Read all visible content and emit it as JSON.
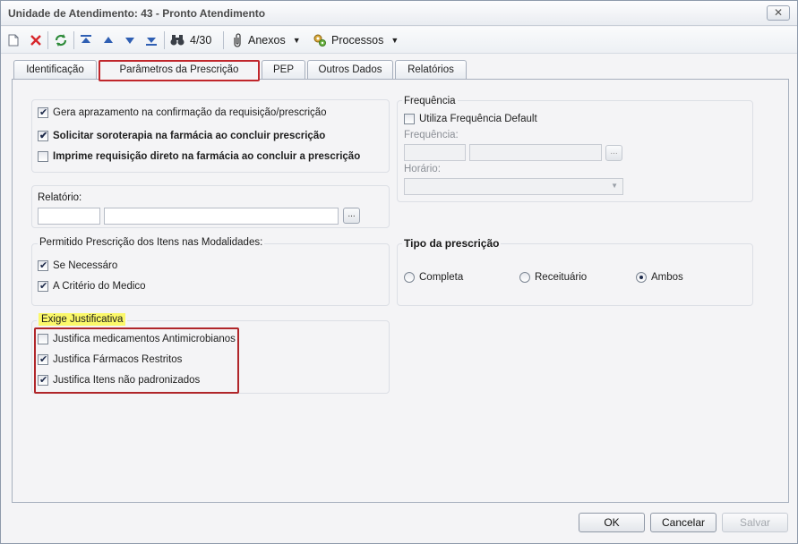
{
  "window": {
    "title": "Unidade de Atendimento: 43 - Pronto Atendimento",
    "close_symbol": "✕"
  },
  "toolbar": {
    "record_counter": "4/30",
    "anexos_label": "Anexos",
    "processos_label": "Processos",
    "icons": [
      "new-document-icon",
      "delete-icon",
      "refresh-icon",
      "first-record-icon",
      "previous-record-icon",
      "next-record-icon",
      "last-record-icon",
      "binoculars-icon",
      "paperclip-icon",
      "processes-icon"
    ]
  },
  "tabs": [
    {
      "label": "Identificação",
      "active": false
    },
    {
      "label": "Parâmetros da Prescrição",
      "active": true
    },
    {
      "label": "PEP",
      "active": false
    },
    {
      "label": "Outros Dados",
      "active": false
    },
    {
      "label": "Relatórios",
      "active": false
    }
  ],
  "prescricao_options": [
    {
      "label": "Gera aprazamento na confirmação da requisição/prescrição",
      "checked": true,
      "bold": false
    },
    {
      "label": "Solicitar soroterapia na farmácia ao concluir prescrição",
      "checked": true,
      "bold": true
    },
    {
      "label": "Imprime requisição direto na farmácia ao concluir a prescrição",
      "checked": false,
      "bold": true
    }
  ],
  "relatorio": {
    "label": "Relatório:",
    "code_value": "",
    "name_value": "",
    "lookup_button": "..."
  },
  "modalidades": {
    "title": "Permitido Prescrição dos Itens nas Modalidades:",
    "items": [
      {
        "label": "Se Necessáro",
        "checked": true
      },
      {
        "label": "A Critério do Medico",
        "checked": true
      }
    ]
  },
  "justificativa": {
    "title": "Exige Justificativa",
    "items": [
      {
        "label": "Justifica medicamentos Antimicrobianos",
        "checked": false
      },
      {
        "label": "Justifica Fármacos Restritos",
        "checked": true
      },
      {
        "label": "Justifica Itens não padronizados",
        "checked": true
      }
    ]
  },
  "frequencia": {
    "title": "Frequência",
    "default_label": "Utiliza Frequência Default",
    "default_checked": false,
    "frequencia_label": "Frequência:",
    "frequencia_code": "",
    "frequencia_name": "",
    "lookup_button": "...",
    "horario_label": "Horário:",
    "horario_value": ""
  },
  "tipo_prescricao": {
    "title": "Tipo da prescrição",
    "options": [
      {
        "label": "Completa",
        "selected": false
      },
      {
        "label": "Receituário",
        "selected": false
      },
      {
        "label": "Ambos",
        "selected": true
      }
    ]
  },
  "footer": {
    "ok_label": "OK",
    "cancel_label": "Cancelar",
    "save_label": "Salvar"
  },
  "colors": {
    "highlight_red": "#b0262a",
    "highlight_yellow": "#fbf86a"
  }
}
